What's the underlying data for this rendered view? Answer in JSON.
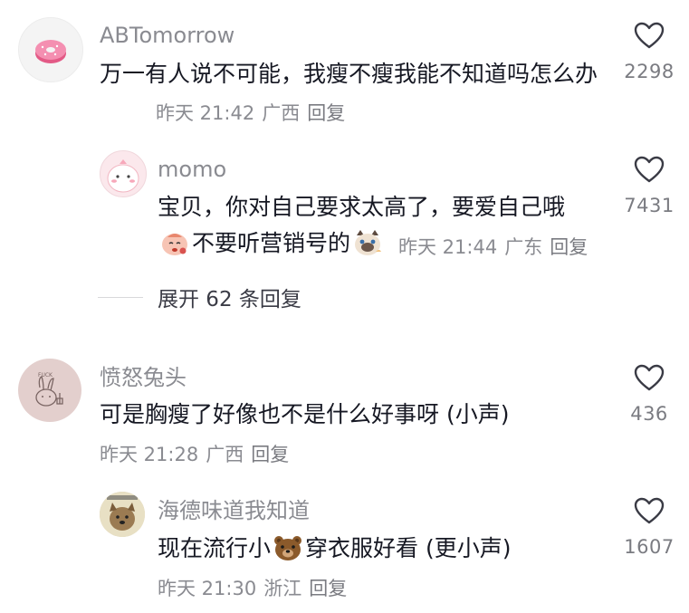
{
  "comments": [
    {
      "username": "ABTomorrow",
      "text": "万一有人说不可能，我瘦不瘦我能不知道吗怎么办",
      "time": "昨天 21:42",
      "location": "广西",
      "reply": "回复",
      "likes": "2298",
      "avatar_icon": "donut-icon"
    },
    {
      "username": "momo",
      "text_part1": "宝贝，你对自己要求太高了，要爱自己哦",
      "text_part2": "不要听营销号的",
      "time": "昨天 21:44",
      "location": "广东",
      "reply": "回复",
      "likes": "7431",
      "avatar_icon": "pink-cartoon-icon"
    },
    {
      "username": "愤怒兔头",
      "text": "可是胸瘦了好像也不是什么好事呀 (小声)",
      "time": "昨天 21:28",
      "location": "广西",
      "reply": "回复",
      "likes": "436",
      "avatar_icon": "rabbit-drawing-icon"
    },
    {
      "username": "海德味道我知道",
      "text_part1": "现在流行小",
      "text_part2": "穿衣服好看 (更小声)",
      "time": "昨天 21:30",
      "location": "浙江",
      "reply": "回复",
      "likes": "1607",
      "avatar_icon": "dog-photo-icon"
    }
  ],
  "expand_replies": "展开 62 条回复",
  "colors": {
    "text": "#161823",
    "secondary": "#8a8b91",
    "background": "#ffffff"
  }
}
